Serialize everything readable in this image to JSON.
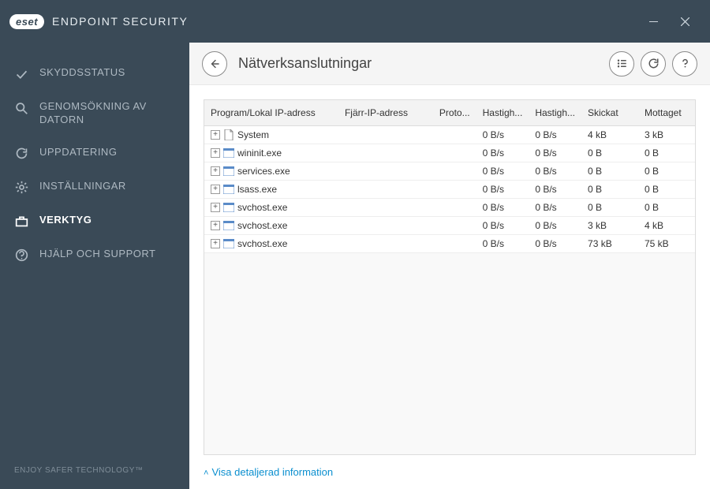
{
  "titlebar": {
    "brand": "eset",
    "title": "ENDPOINT SECURITY"
  },
  "sidebar": {
    "items": [
      {
        "label": "SKYDDSSTATUS"
      },
      {
        "label": "GENOMSÖKNING AV DATORN"
      },
      {
        "label": "UPPDATERING"
      },
      {
        "label": "INSTÄLLNINGAR"
      },
      {
        "label": "VERKTYG"
      },
      {
        "label": "HJÄLP OCH SUPPORT"
      }
    ],
    "footer": "ENJOY SAFER TECHNOLOGY™"
  },
  "header": {
    "title": "Nätverksanslutningar"
  },
  "table": {
    "columns": {
      "program": "Program/Lokal IP-adress",
      "remote": "Fjärr-IP-adress",
      "proto": "Proto...",
      "speed_in": "Hastigh...",
      "speed_out": "Hastigh...",
      "sent": "Skickat",
      "received": "Mottaget"
    },
    "rows": [
      {
        "program": "System",
        "remote": "",
        "proto": "",
        "speed_in": "0 B/s",
        "speed_out": "0 B/s",
        "sent": "4 kB",
        "received": "3 kB",
        "icon": "doc"
      },
      {
        "program": "wininit.exe",
        "remote": "",
        "proto": "",
        "speed_in": "0 B/s",
        "speed_out": "0 B/s",
        "sent": "0 B",
        "received": "0 B",
        "icon": "app"
      },
      {
        "program": "services.exe",
        "remote": "",
        "proto": "",
        "speed_in": "0 B/s",
        "speed_out": "0 B/s",
        "sent": "0 B",
        "received": "0 B",
        "icon": "app"
      },
      {
        "program": "lsass.exe",
        "remote": "",
        "proto": "",
        "speed_in": "0 B/s",
        "speed_out": "0 B/s",
        "sent": "0 B",
        "received": "0 B",
        "icon": "app"
      },
      {
        "program": "svchost.exe",
        "remote": "",
        "proto": "",
        "speed_in": "0 B/s",
        "speed_out": "0 B/s",
        "sent": "0 B",
        "received": "0 B",
        "icon": "app"
      },
      {
        "program": "svchost.exe",
        "remote": "",
        "proto": "",
        "speed_in": "0 B/s",
        "speed_out": "0 B/s",
        "sent": "3 kB",
        "received": "4 kB",
        "icon": "app"
      },
      {
        "program": "svchost.exe",
        "remote": "",
        "proto": "",
        "speed_in": "0 B/s",
        "speed_out": "0 B/s",
        "sent": "73 kB",
        "received": "75 kB",
        "icon": "app"
      }
    ]
  },
  "footer": {
    "detail_toggle": "Visa detaljerad information"
  }
}
